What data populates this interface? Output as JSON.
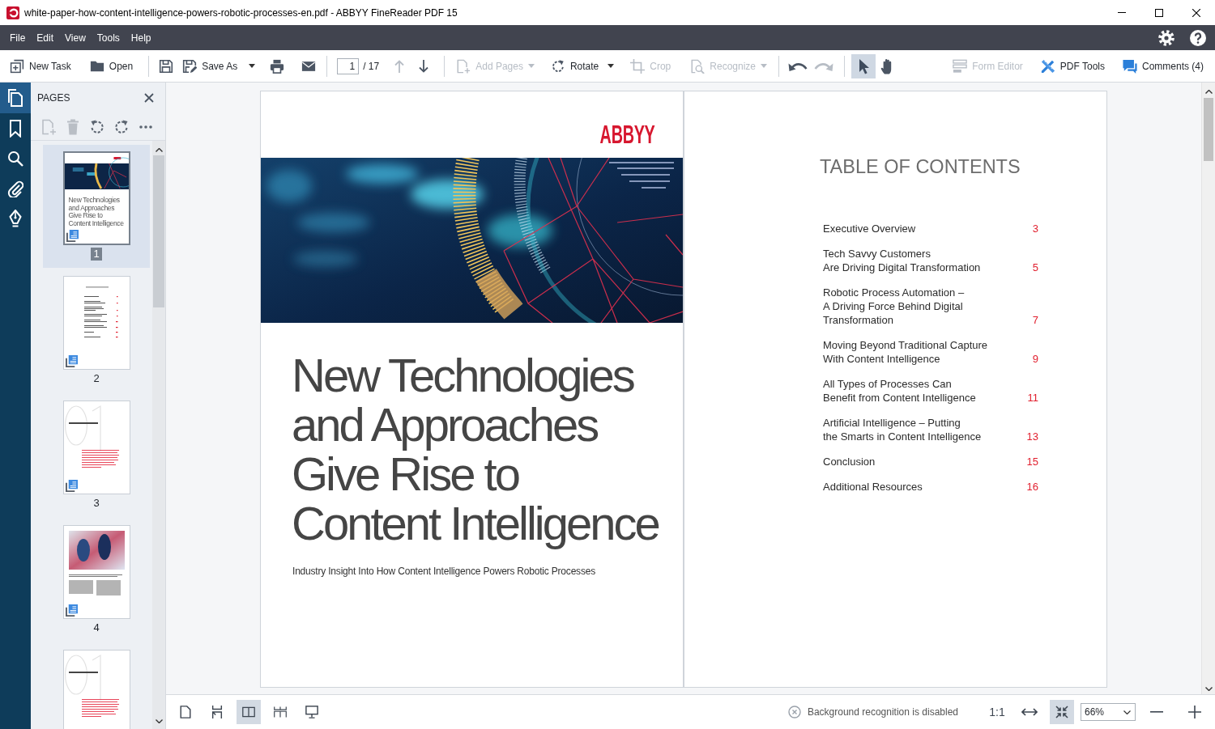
{
  "window": {
    "title": "white-paper-how-content-intelligence-powers-robotic-processes-en.pdf - ABBYY FineReader PDF 15"
  },
  "menu": [
    "File",
    "Edit",
    "View",
    "Tools",
    "Help"
  ],
  "toolbar": {
    "new_task": {
      "label": "New Task"
    },
    "open": {
      "label": "Open"
    },
    "save_as": {
      "label": "Save As"
    },
    "page_field": {
      "value": "1",
      "total": "/ 17"
    },
    "previous_page": {
      "disabled": true
    },
    "next_page": {
      "disabled": false
    },
    "add_pages": {
      "label": "Add Pages",
      "disabled": true
    },
    "rotate": {
      "label": "Rotate",
      "disabled": false
    },
    "crop": {
      "label": "Crop",
      "disabled": true
    },
    "recognize": {
      "label": "Recognize",
      "disabled": true
    },
    "undo": {
      "disabled": false
    },
    "redo": {
      "disabled": true
    },
    "pointer_tools": [
      {
        "kind": "select",
        "selected": true
      },
      {
        "kind": "hand",
        "selected": false
      }
    ],
    "form_editor": {
      "label": "Form Editor",
      "disabled": true
    },
    "pdf_tools": {
      "label": "PDF Tools"
    },
    "comments": {
      "label": "Comments (4)"
    }
  },
  "rail": [
    {
      "kind": "pages",
      "selected": true
    },
    {
      "kind": "bookmarks",
      "selected": false
    },
    {
      "kind": "search",
      "selected": false
    },
    {
      "kind": "attachments",
      "selected": false
    },
    {
      "kind": "signatures",
      "selected": false
    }
  ],
  "pages_panel": {
    "title": "PAGES",
    "tools": [
      {
        "kind": "add",
        "disabled": true
      },
      {
        "kind": "delete",
        "disabled": true
      },
      {
        "kind": "rotate-left",
        "disabled": false
      },
      {
        "kind": "rotate-right",
        "disabled": false
      },
      {
        "kind": "more",
        "disabled": false
      }
    ],
    "thumbnails": [
      {
        "kind": "cover",
        "label": "1",
        "selected": true,
        "title_lines": [
          "New Technologies",
          "and Approaches",
          "Give Rise to",
          "Content Intelligence"
        ]
      },
      {
        "kind": "toc",
        "label": "2",
        "selected": false
      },
      {
        "kind": "chapter",
        "label": "3",
        "selected": false
      },
      {
        "kind": "photo",
        "label": "4",
        "selected": false
      },
      {
        "kind": "chapter",
        "selected": false
      }
    ]
  },
  "document": {
    "pages": [
      {
        "kind": "cover",
        "logo": "ABBYY",
        "title_lines": [
          "New Technologies",
          "and Approaches",
          "Give Rise to",
          "Content Intelligence"
        ],
        "subtitle": "Industry Insight Into How Content Intelligence Powers Robotic Processes"
      },
      {
        "kind": "toc",
        "heading": "TABLE OF CONTENTS",
        "entries": [
          {
            "lines": [
              "Executive Overview"
            ],
            "page": "3"
          },
          {
            "lines": [
              "Tech Savvy Customers",
              "Are Driving Digital Transformation"
            ],
            "page": "5"
          },
          {
            "lines": [
              "Robotic Process Automation –",
              "A Driving Force Behind Digital",
              "Transformation"
            ],
            "page": "7"
          },
          {
            "lines": [
              "Moving Beyond Traditional Capture",
              "With Content Intelligence"
            ],
            "page": "9"
          },
          {
            "lines": [
              "All Types of Processes Can",
              "Benefit from Content Intelligence"
            ],
            "page": "11"
          },
          {
            "lines": [
              "Artificial Intelligence – Putting",
              "the Smarts in Content Intelligence"
            ],
            "page": "13"
          },
          {
            "lines": [
              "Conclusion"
            ],
            "page": "15"
          },
          {
            "lines": [
              "Additional Resources"
            ],
            "page": "16"
          }
        ]
      }
    ]
  },
  "status_bar": {
    "view_modes": [
      {
        "kind": "single",
        "selected": false
      },
      {
        "kind": "scroll",
        "selected": false
      },
      {
        "kind": "two-page",
        "selected": true
      },
      {
        "kind": "two-page-scroll",
        "selected": false
      },
      {
        "kind": "presentation",
        "selected": false
      }
    ],
    "recognition": "Background recognition is disabled",
    "zoom_tools": [
      {
        "kind": "actual-size",
        "label": "1:1",
        "selected": false
      },
      {
        "kind": "fit-width",
        "selected": false
      },
      {
        "kind": "fit-page",
        "selected": true
      }
    ],
    "zoom": {
      "value": "66%"
    }
  }
}
